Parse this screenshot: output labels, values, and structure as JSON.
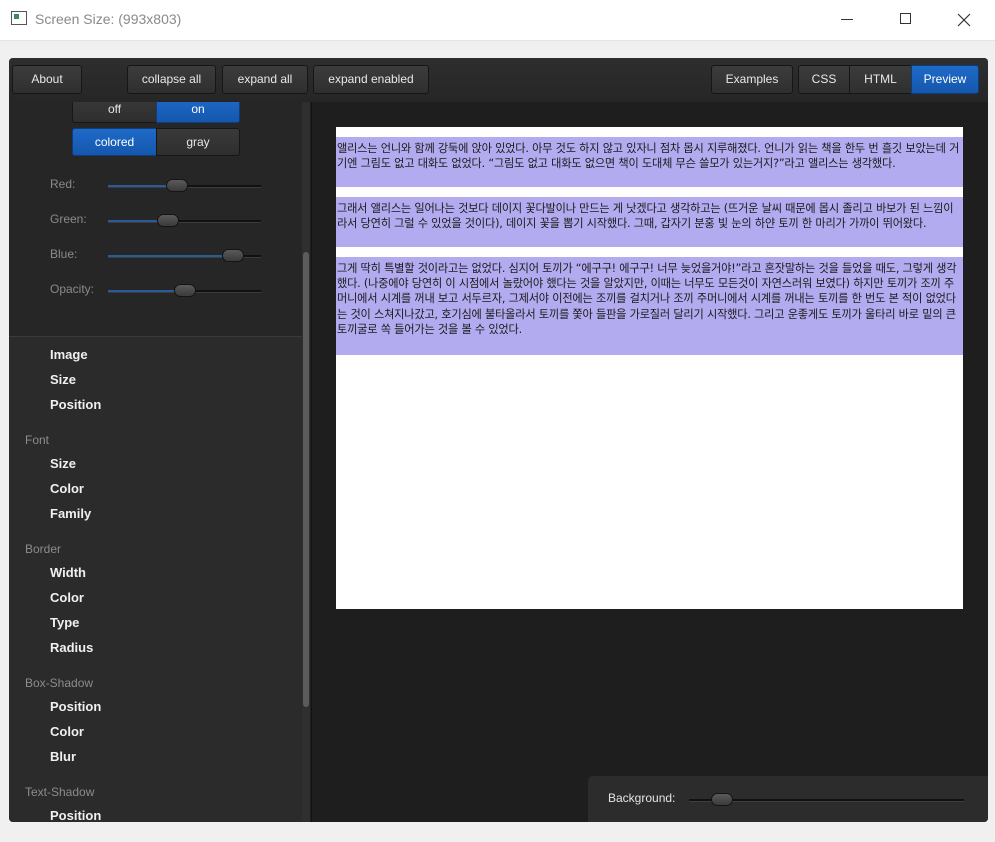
{
  "window": {
    "title": "Screen Size: (993x803)"
  },
  "toolbar": {
    "about": "About",
    "collapse_all": "collapse all",
    "expand_all": "expand all",
    "expand_enabled": "expand enabled",
    "examples": "Examples",
    "tabs": [
      {
        "label": "CSS",
        "active": false
      },
      {
        "label": "HTML",
        "active": false
      },
      {
        "label": "Preview",
        "active": true
      }
    ]
  },
  "controls": {
    "toggle": {
      "off": "off",
      "on": "on",
      "selected": "on"
    },
    "color_mode": {
      "colored": "colored",
      "gray": "gray",
      "selected": "colored"
    },
    "sliders": [
      {
        "label": "Red:",
        "value": 0.45
      },
      {
        "label": "Green:",
        "value": 0.39
      },
      {
        "label": "Blue:",
        "value": 0.82
      },
      {
        "label": "Opacity:",
        "value": 0.5
      }
    ]
  },
  "sidebar": {
    "groups": [
      {
        "category": "",
        "items": [
          "Image",
          "Size",
          "Position"
        ]
      },
      {
        "category": "Font",
        "items": [
          "Size",
          "Color",
          "Family"
        ]
      },
      {
        "category": "Border",
        "items": [
          "Width",
          "Color",
          "Type",
          "Radius"
        ]
      },
      {
        "category": "Box-Shadow",
        "items": [
          "Position",
          "Color",
          "Blur"
        ]
      },
      {
        "category": "Text-Shadow",
        "items": [
          "Position"
        ]
      }
    ]
  },
  "preview": {
    "paragraphs": [
      "앨리스는 언니와 함께 강둑에 앉아 있었다. 아무 것도 하지 않고 있자니 점차 몹시 지루해졌다. 언니가 읽는 책을 한두 번 흘깃 보았는데 거기엔 그림도 없고 대화도 없었다. “그림도 없고 대화도 없으면 책이 도대체 무슨 쓸모가 있는거지?”라고 앨리스는 생각했다.",
      "그래서 앨리스는 일어나는 것보다 데이지 꽃다발이나 만드는 게 낫겠다고 생각하고는 (뜨거운 날씨 때문에 몹시 졸리고 바보가 된 느낌이라서 당연히 그럴 수 있었을 것이다), 데이지 꽃을 뽑기 시작했다. 그때, 갑자기 분홍 빛 눈의 하얀 토끼 한 마리가 가까이 뛰어왔다.",
      "그게 딱히 특별할 것이라고는 없었다. 심지어 토끼가 “에구구! 에구구! 너무 늦었을거야!”라고 혼잣말하는 것을 들었을 때도, 그렇게 생각했다. (나중에야 당연히 이 시점에서 놀랐어야 했다는 것을 알았지만, 이때는 너무도 모든것이 자연스러워 보였다) 하지만 토끼가 조끼 주머니에서 시계를 꺼내 보고 서두르자, 그제서야 이전에는 조끼를 걸치거나 조끼 주머니에서 시계를 꺼내는 토끼를 한 번도 본 적이 없었다는 것이 스쳐지나갔고, 호기심에 불타올라서 토끼를 쫓아 들판을 가로질러 달리기 시작했다. 그리고 운좋게도 토끼가 울타리 바로 밑의 큰 토끼굴로 쏙 들어가는 것을 볼 수 있었다."
    ],
    "highlight_color": "#b3abef"
  },
  "background": {
    "label": "Background:",
    "value": 0.12
  },
  "colors": {
    "accent": "#1a62bd",
    "panel": "#2b2b2b",
    "canvas": "#1e1e1e"
  }
}
